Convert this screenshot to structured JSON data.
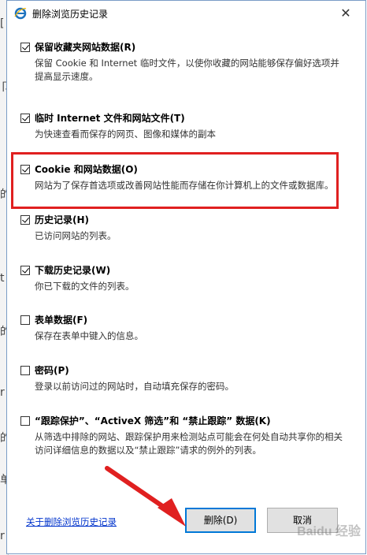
{
  "background_chars": [
    "[",
    "卩",
    "r",
    "的",
    "ō",
    "t",
    "的",
    "r",
    "的",
    "单",
    "ä",
    "r"
  ],
  "dialog": {
    "title": "删除浏览历史记录",
    "close_icon": "close-icon"
  },
  "options": [
    {
      "title": "保留收藏夹网站数据(R)",
      "desc": "保留 Cookie 和 Internet 临时文件，以使你收藏的网站能够保存偏好选项并提高显示速度。",
      "checked": true
    },
    {
      "title": "临时 Internet 文件和网站文件(T)",
      "desc": "为快速查看而保存的网页、图像和媒体的副本",
      "checked": true
    },
    {
      "title": "Cookie 和网站数据(O)",
      "desc": "网站为了保存首选项或改善网站性能而存储在你计算机上的文件或数据库。",
      "checked": true
    },
    {
      "title": "历史记录(H)",
      "desc": "已访问网站的列表。",
      "checked": true
    },
    {
      "title": "下载历史记录(W)",
      "desc": "你已下载的文件的列表。",
      "checked": true
    },
    {
      "title": "表单数据(F)",
      "desc": "保存在表单中键入的信息。",
      "checked": false
    },
    {
      "title": "密码(P)",
      "desc": "登录以前访问过的网站时，自动填充保存的密码。",
      "checked": false
    },
    {
      "title": "“跟踪保护”、“ActiveX 筛选”和 “禁止跟踪” 数据(K)",
      "desc": "从筛选中排除的网站、跟踪保护用来检测站点可能会在何处自动共享你的相关访问详细信息的数据以及“禁止跟踪”请求的例外的列表。",
      "checked": false
    }
  ],
  "footer": {
    "link": "关于删除浏览历史记录",
    "delete_button": "删除(D)",
    "cancel_button": "取消"
  },
  "watermark": "Baidu 经验",
  "colors": {
    "highlight": "#e02020",
    "link": "#0033cc",
    "accent": "#0078d7"
  }
}
